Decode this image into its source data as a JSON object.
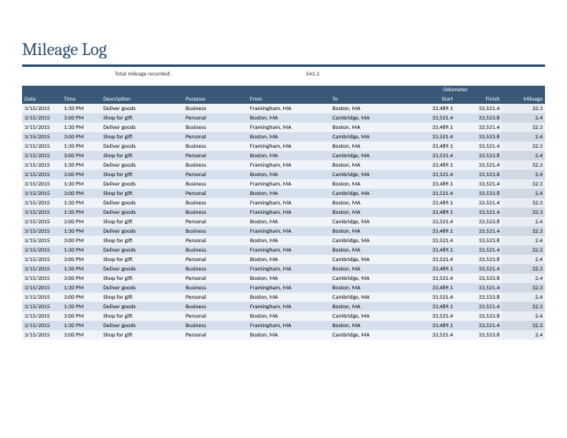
{
  "title": "Mileage Log",
  "summary": {
    "label": "Total mileage recorded:",
    "value": "543.2"
  },
  "columns": {
    "date": "Date",
    "time": "Time",
    "description": "Description",
    "purpose": "Purpose",
    "from": "From",
    "to": "To",
    "odometer_group": "Odometer",
    "start": "Start",
    "finish": "Finish",
    "mileage": "Mileage"
  },
  "rows": [
    {
      "date": "3/15/2015",
      "time": "1:30 PM",
      "description": "Deliver goods",
      "purpose": "Business",
      "from": "Framingham, MA",
      "to": "Boston, MA",
      "start": "33,489.1",
      "finish": "33,521.4",
      "mileage": "32.3"
    },
    {
      "date": "3/15/2015",
      "time": "3:00 PM",
      "description": "Shop for gift",
      "purpose": "Personal",
      "from": "Boston, MA",
      "to": "Cambridge, MA",
      "start": "33,521.4",
      "finish": "33,523.8",
      "mileage": "2.4"
    },
    {
      "date": "3/15/2015",
      "time": "1:30 PM",
      "description": "Deliver goods",
      "purpose": "Business",
      "from": "Framingham, MA",
      "to": "Boston, MA",
      "start": "33,489.1",
      "finish": "33,521.4",
      "mileage": "32.3"
    },
    {
      "date": "3/15/2015",
      "time": "3:00 PM",
      "description": "Shop for gift",
      "purpose": "Personal",
      "from": "Boston, MA",
      "to": "Cambridge, MA",
      "start": "33,521.4",
      "finish": "33,523.8",
      "mileage": "2.4"
    },
    {
      "date": "3/15/2015",
      "time": "1:30 PM",
      "description": "Deliver goods",
      "purpose": "Business",
      "from": "Framingham, MA",
      "to": "Boston, MA",
      "start": "33,489.1",
      "finish": "33,521.4",
      "mileage": "32.3"
    },
    {
      "date": "3/15/2015",
      "time": "3:00 PM",
      "description": "Shop for gift",
      "purpose": "Personal",
      "from": "Boston, MA",
      "to": "Cambridge, MA",
      "start": "33,521.4",
      "finish": "33,523.8",
      "mileage": "2.4"
    },
    {
      "date": "3/15/2015",
      "time": "1:30 PM",
      "description": "Deliver goods",
      "purpose": "Business",
      "from": "Framingham, MA",
      "to": "Boston, MA",
      "start": "33,489.1",
      "finish": "33,521.4",
      "mileage": "32.3"
    },
    {
      "date": "3/15/2015",
      "time": "3:00 PM",
      "description": "Shop for gift",
      "purpose": "Personal",
      "from": "Boston, MA",
      "to": "Cambridge, MA",
      "start": "33,521.4",
      "finish": "33,523.8",
      "mileage": "2.4"
    },
    {
      "date": "3/15/2015",
      "time": "1:30 PM",
      "description": "Deliver goods",
      "purpose": "Business",
      "from": "Framingham, MA",
      "to": "Boston, MA",
      "start": "33,489.1",
      "finish": "33,521.4",
      "mileage": "32.3"
    },
    {
      "date": "3/15/2015",
      "time": "3:00 PM",
      "description": "Shop for gift",
      "purpose": "Personal",
      "from": "Boston, MA",
      "to": "Cambridge, MA",
      "start": "33,521.4",
      "finish": "33,523.8",
      "mileage": "2.4"
    },
    {
      "date": "3/15/2015",
      "time": "1:30 PM",
      "description": "Deliver goods",
      "purpose": "Business",
      "from": "Framingham, MA",
      "to": "Boston, MA",
      "start": "33,489.1",
      "finish": "33,521.4",
      "mileage": "32.3"
    },
    {
      "date": "3/15/2015",
      "time": "1:30 PM",
      "description": "Deliver goods",
      "purpose": "Business",
      "from": "Framingham, MA",
      "to": "Boston, MA",
      "start": "33,489.1",
      "finish": "33,521.4",
      "mileage": "32.3"
    },
    {
      "date": "3/15/2015",
      "time": "3:00 PM",
      "description": "Shop for gift",
      "purpose": "Personal",
      "from": "Boston, MA",
      "to": "Cambridge, MA",
      "start": "33,521.4",
      "finish": "33,523.8",
      "mileage": "2.4"
    },
    {
      "date": "3/15/2015",
      "time": "1:30 PM",
      "description": "Deliver goods",
      "purpose": "Business",
      "from": "Framingham, MA",
      "to": "Boston, MA",
      "start": "33,489.1",
      "finish": "33,521.4",
      "mileage": "32.3"
    },
    {
      "date": "3/15/2015",
      "time": "3:00 PM",
      "description": "Shop for gift",
      "purpose": "Personal",
      "from": "Boston, MA",
      "to": "Cambridge, MA",
      "start": "33,521.4",
      "finish": "33,523.8",
      "mileage": "2.4"
    },
    {
      "date": "3/15/2015",
      "time": "1:30 PM",
      "description": "Deliver goods",
      "purpose": "Business",
      "from": "Framingham, MA",
      "to": "Boston, MA",
      "start": "33,489.1",
      "finish": "33,521.4",
      "mileage": "32.3"
    },
    {
      "date": "3/15/2015",
      "time": "3:00 PM",
      "description": "Shop for gift",
      "purpose": "Personal",
      "from": "Boston, MA",
      "to": "Cambridge, MA",
      "start": "33,521.4",
      "finish": "33,523.8",
      "mileage": "2.4"
    },
    {
      "date": "3/15/2015",
      "time": "1:30 PM",
      "description": "Deliver goods",
      "purpose": "Business",
      "from": "Framingham, MA",
      "to": "Boston, MA",
      "start": "33,489.1",
      "finish": "33,521.4",
      "mileage": "32.3"
    },
    {
      "date": "3/15/2015",
      "time": "3:00 PM",
      "description": "Shop for gift",
      "purpose": "Personal",
      "from": "Boston, MA",
      "to": "Cambridge, MA",
      "start": "33,521.4",
      "finish": "33,523.8",
      "mileage": "2.4"
    },
    {
      "date": "3/15/2015",
      "time": "1:30 PM",
      "description": "Deliver goods",
      "purpose": "Business",
      "from": "Framingham, MA",
      "to": "Boston, MA",
      "start": "33,489.1",
      "finish": "33,521.4",
      "mileage": "32.3"
    },
    {
      "date": "3/15/2015",
      "time": "3:00 PM",
      "description": "Shop for gift",
      "purpose": "Personal",
      "from": "Boston, MA",
      "to": "Cambridge, MA",
      "start": "33,521.4",
      "finish": "33,523.8",
      "mileage": "2.4"
    },
    {
      "date": "3/15/2015",
      "time": "1:30 PM",
      "description": "Deliver goods",
      "purpose": "Business",
      "from": "Framingham, MA",
      "to": "Boston, MA",
      "start": "33,489.1",
      "finish": "33,521.4",
      "mileage": "32.3"
    },
    {
      "date": "3/15/2015",
      "time": "3:00 PM",
      "description": "Shop for gift",
      "purpose": "Personal",
      "from": "Boston, MA",
      "to": "Cambridge, MA",
      "start": "33,521.4",
      "finish": "33,523.8",
      "mileage": "2.4"
    },
    {
      "date": "3/15/2015",
      "time": "1:30 PM",
      "description": "Deliver goods",
      "purpose": "Business",
      "from": "Framingham, MA",
      "to": "Boston, MA",
      "start": "33,489.1",
      "finish": "33,521.4",
      "mileage": "32.3"
    },
    {
      "date": "3/15/2015",
      "time": "3:00 PM",
      "description": "Shop for gift",
      "purpose": "Personal",
      "from": "Boston, MA",
      "to": "Cambridge, MA",
      "start": "33,521.4",
      "finish": "33,523.8",
      "mileage": "2.4"
    }
  ]
}
